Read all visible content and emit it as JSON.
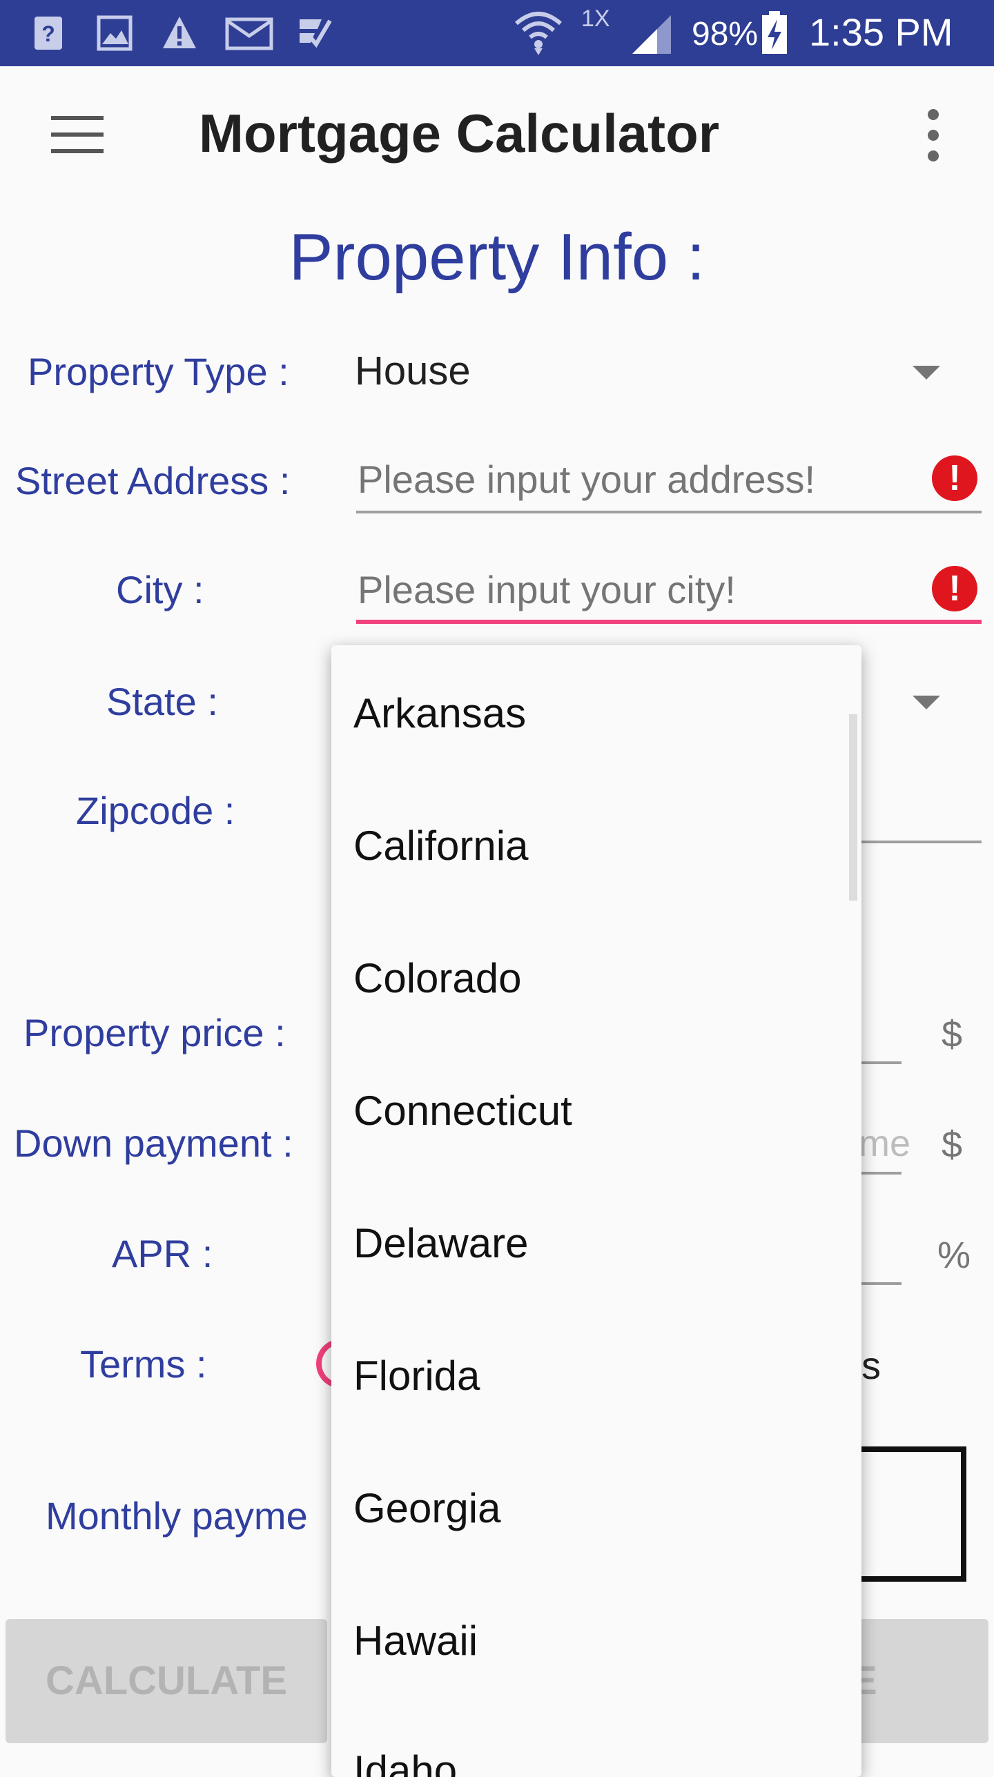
{
  "status_bar": {
    "network": "1X",
    "battery": "98%",
    "time": "1:35 PM",
    "icons": [
      "help-doc-icon",
      "image-icon",
      "warning-icon",
      "mail-icon",
      "check-icon",
      "wifi-icon",
      "signal-icon",
      "battery-charging-icon"
    ]
  },
  "app_bar": {
    "title": "Mortgage Calculator"
  },
  "form": {
    "heading": "Property Info :",
    "property_type": {
      "label": "Property Type :",
      "value": "House"
    },
    "street": {
      "label": "Street Address :",
      "placeholder": "Please input your address!"
    },
    "city": {
      "label": "City :",
      "placeholder": "Please input your city!"
    },
    "state": {
      "label": "State :"
    },
    "zipcode": {
      "label": "Zipcode :"
    },
    "property_price": {
      "label": "Property price :",
      "suffix": "$"
    },
    "down_payment": {
      "label": "Down payment :",
      "suffix": "$",
      "partial_placeholder": "me"
    },
    "apr": {
      "label": "APR :",
      "suffix": "%"
    },
    "terms": {
      "label": "Terms :",
      "partial_text": "s"
    },
    "monthly_payment": {
      "label": "Monthly payme"
    }
  },
  "buttons": {
    "calculate": "CALCULATE",
    "right_partial": "E"
  },
  "state_dropdown": {
    "options": [
      "Arkansas",
      "California",
      "Colorado",
      "Connecticut",
      "Delaware",
      "Florida",
      "Georgia",
      "Hawaii",
      "Idaho"
    ]
  },
  "colors": {
    "status_bar": "#2e3e94",
    "label_blue": "#2f3e9e",
    "error_red": "#e0161e",
    "focus_pink": "#f0417a"
  }
}
